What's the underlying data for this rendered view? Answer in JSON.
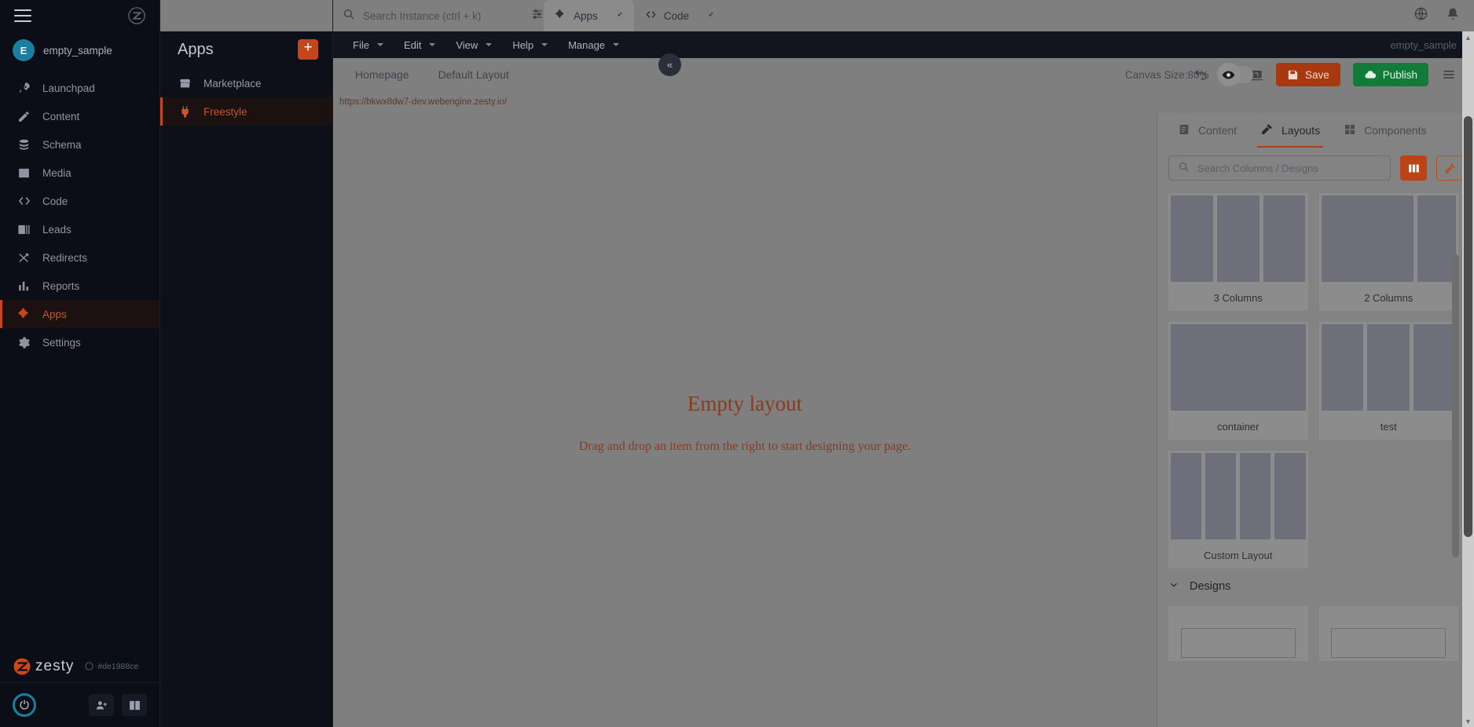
{
  "sidebar": {
    "account": {
      "initial": "E",
      "name": "empty_sample"
    },
    "items": [
      {
        "label": "Launchpad",
        "icon": "rocket-icon"
      },
      {
        "label": "Content",
        "icon": "pencil-icon"
      },
      {
        "label": "Schema",
        "icon": "database-icon"
      },
      {
        "label": "Media",
        "icon": "image-icon"
      },
      {
        "label": "Code",
        "icon": "code-icon"
      },
      {
        "label": "Leads",
        "icon": "contact-icon"
      },
      {
        "label": "Redirects",
        "icon": "shuffle-icon"
      },
      {
        "label": "Reports",
        "icon": "bar-chart-icon"
      },
      {
        "label": "Apps",
        "icon": "puzzle-icon"
      },
      {
        "label": "Settings",
        "icon": "gear-icon"
      }
    ],
    "brand": "zesty",
    "commit": "#de1988ce"
  },
  "apps_panel": {
    "title": "Apps",
    "add_label": "+",
    "items": [
      {
        "label": "Marketplace",
        "icon": "store-icon"
      },
      {
        "label": "Freestyle",
        "icon": "plug-icon"
      }
    ]
  },
  "topbar": {
    "search_placeholder": "Search Instance (ctrl + k)",
    "tabs": [
      {
        "label": "Apps",
        "icon": "puzzle-icon"
      },
      {
        "label": "Code",
        "icon": "code-icon"
      }
    ]
  },
  "menubar": {
    "items": [
      "File",
      "Edit",
      "View",
      "Help",
      "Manage"
    ],
    "instance": "empty_sample"
  },
  "editor_toolbar": {
    "page_select": "Homepage",
    "layout_select": "Default Layout",
    "canvas_size": "Canvas Size:80%",
    "save_label": "Save",
    "publish_label": "Publish"
  },
  "urlbar": {
    "url": "https://bkwx8dw7-dev.webengine.zesty.io/"
  },
  "canvas": {
    "empty_title": "Empty layout",
    "empty_subtitle": "Drag and drop an item from the right to start designing your page."
  },
  "right_panel": {
    "tabs": [
      {
        "label": "Content",
        "icon": "document-icon"
      },
      {
        "label": "Layouts",
        "icon": "tools-icon"
      },
      {
        "label": "Components",
        "icon": "grid-icon"
      }
    ],
    "search_placeholder": "Search Columns / Designs",
    "layout_cards": [
      {
        "label": "3 Columns",
        "cols": 3
      },
      {
        "label": "2 Columns",
        "cols": 2
      },
      {
        "label": "container",
        "cols": 1
      },
      {
        "label": "test",
        "cols": 3
      }
    ],
    "spotlight_card": {
      "label": "Custom Layout",
      "cols": 4,
      "edit_icon": "pencil-icon",
      "delete_icon": "trash-icon",
      "drag_icon": "move-cursor-icon"
    },
    "designs_header": "Designs"
  },
  "colors": {
    "accent_orange": "#c4461c",
    "publish_green": "#137b3a",
    "save_red": "#a8380f",
    "sidebar_bg": "#0b0e17",
    "overlay_gray": "#7f7f7f"
  }
}
